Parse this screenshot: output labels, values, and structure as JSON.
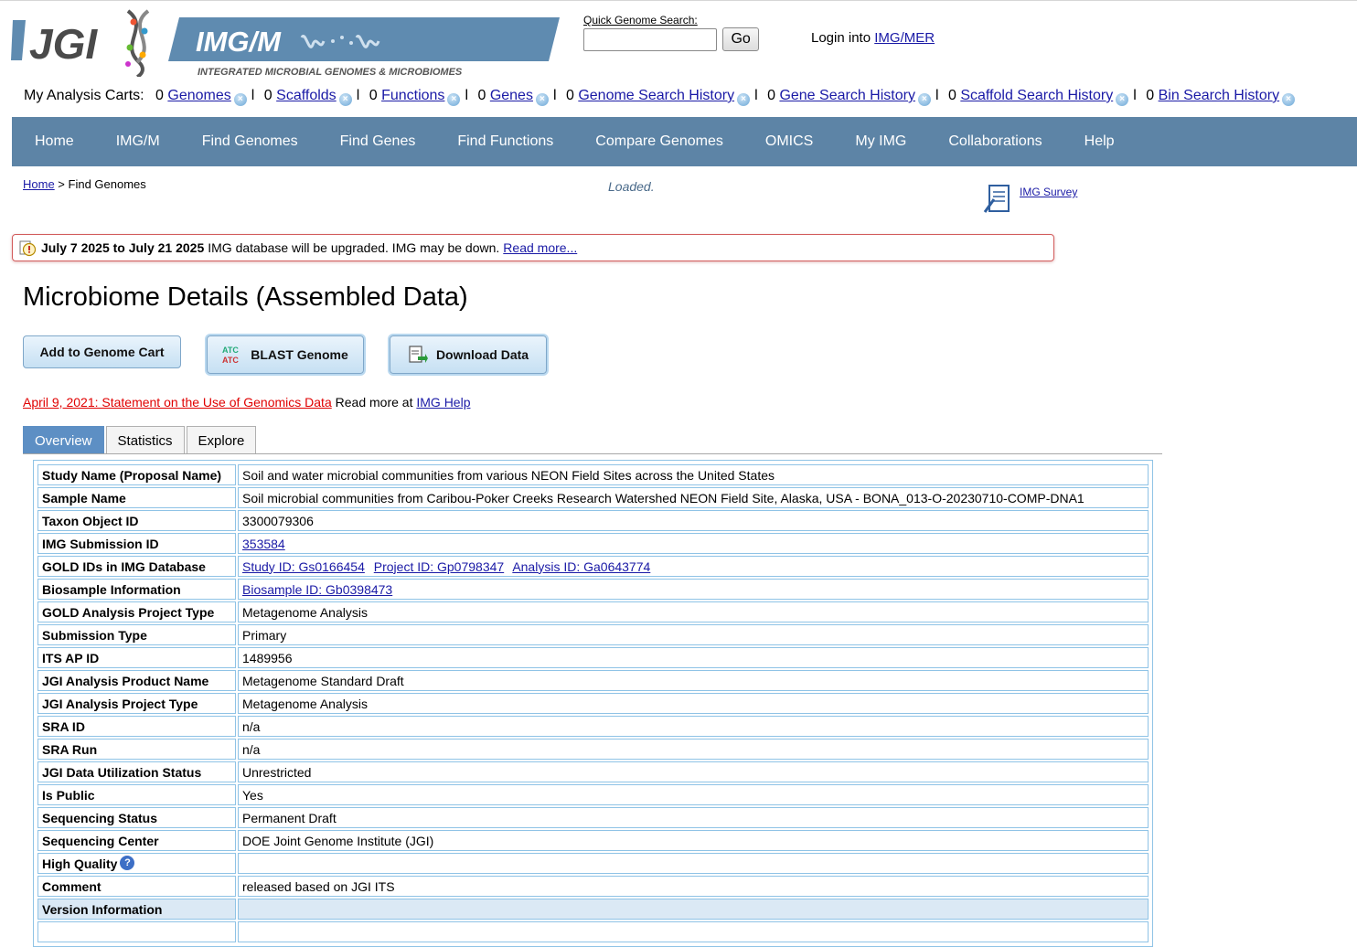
{
  "header": {
    "jgi_logo_text": "JGI",
    "img_banner_title": "IMG/M",
    "img_banner_subtitle": "INTEGRATED MICROBIAL GENOMES & MICROBIOMES",
    "quick_search_label": "Quick Genome Search:",
    "quick_search_value": "",
    "go_label": "Go",
    "login_prefix": "Login into ",
    "login_link": "IMG/MER"
  },
  "carts": {
    "label": "My Analysis Carts:",
    "items": [
      {
        "count": "0",
        "label": "Genomes"
      },
      {
        "count": "0",
        "label": "Scaffolds"
      },
      {
        "count": "0",
        "label": "Functions"
      },
      {
        "count": "0",
        "label": "Genes"
      },
      {
        "count": "0",
        "label": "Genome Search History"
      },
      {
        "count": "0",
        "label": "Gene Search History"
      },
      {
        "count": "0",
        "label": "Scaffold Search History"
      },
      {
        "count": "0",
        "label": "Bin Search History"
      }
    ],
    "separator": "l"
  },
  "nav": {
    "items": [
      "Home",
      "IMG/M",
      "Find Genomes",
      "Find Genes",
      "Find Functions",
      "Compare Genomes",
      "OMICS",
      "My IMG",
      "Collaborations",
      "Help"
    ]
  },
  "breadcrumb": {
    "home": "Home",
    "separator": " > ",
    "current": "Find Genomes"
  },
  "status": "Loaded.",
  "survey_link": "IMG Survey",
  "notice": {
    "dates": "July 7 2025 to July 21 2025",
    "message": "IMG database will be upgraded. IMG may be down.",
    "link": "Read more..."
  },
  "page_title": "Microbiome Details (Assembled Data)",
  "actions": {
    "add_to_cart": "Add to Genome Cart",
    "blast": "BLAST Genome",
    "download": "Download Data"
  },
  "statement": {
    "link": "April 9, 2021: Statement on the Use of Genomics Data",
    "middle": " Read more at ",
    "help_link": "IMG Help"
  },
  "tabs": [
    "Overview",
    "Statistics",
    "Explore"
  ],
  "details": {
    "study_name": {
      "key": "Study Name (Proposal Name)",
      "value": "Soil and water microbial communities from various NEON Field Sites across the United States"
    },
    "sample_name": {
      "key": "Sample Name",
      "value": "Soil microbial communities from Caribou-Poker Creeks Research Watershed NEON Field Site, Alaska, USA - BONA_013-O-20230710-COMP-DNA1"
    },
    "taxon_object_id": {
      "key": "Taxon Object ID",
      "value": "3300079306"
    },
    "submission_id": {
      "key": "IMG Submission ID",
      "value": "353584"
    },
    "gold_ids": {
      "key": "GOLD IDs in IMG Database",
      "study": "Study ID: Gs0166454",
      "project": "Project ID: Gp0798347",
      "analysis": "Analysis ID: Ga0643774"
    },
    "biosample": {
      "key": "Biosample Information",
      "value": "Biosample ID: Gb0398473"
    },
    "gold_type": {
      "key": "GOLD Analysis Project Type",
      "value": "Metagenome Analysis"
    },
    "submission_type": {
      "key": "Submission Type",
      "value": "Primary"
    },
    "its_ap_id": {
      "key": "ITS AP ID",
      "value": "1489956"
    },
    "product_name": {
      "key": "JGI Analysis Product Name",
      "value": "Metagenome Standard Draft"
    },
    "project_type": {
      "key": "JGI Analysis Project Type",
      "value": "Metagenome Analysis"
    },
    "sra_id": {
      "key": "SRA ID",
      "value": "n/a"
    },
    "sra_run": {
      "key": "SRA Run",
      "value": "n/a"
    },
    "utilization": {
      "key": "JGI Data Utilization Status",
      "value": "Unrestricted"
    },
    "is_public": {
      "key": "Is Public",
      "value": "Yes"
    },
    "seq_status": {
      "key": "Sequencing Status",
      "value": "Permanent Draft"
    },
    "seq_center": {
      "key": "Sequencing Center",
      "value": "DOE Joint Genome Institute (JGI)"
    },
    "high_quality": {
      "key": "High Quality",
      "value": ""
    },
    "comment": {
      "key": "Comment",
      "value": "released based on JGI ITS"
    },
    "version_info": {
      "key": "Version Information",
      "value": ""
    }
  },
  "colors": {
    "nav_bg": "#5d84a6",
    "link": "#1a1aa6",
    "table_border": "#8fc3e6",
    "active_tab": "#5d8fc4",
    "statement_red": "#e00000"
  }
}
